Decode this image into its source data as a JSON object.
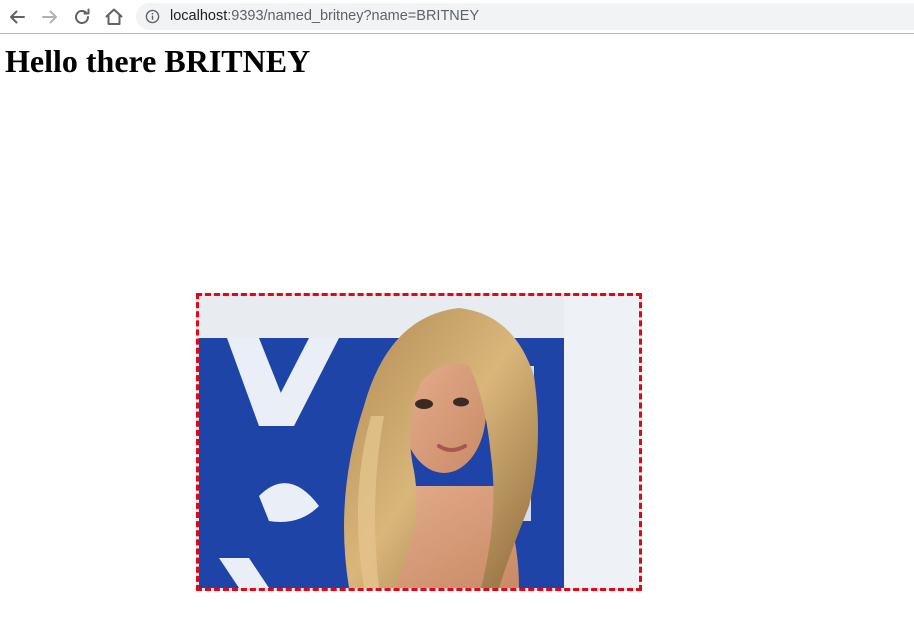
{
  "browser": {
    "url_host": "localhost",
    "url_rest": ":9393/named_britney?name=BRITNEY",
    "icons": [
      "back-arrow-icon",
      "forward-arrow-icon",
      "reload-icon",
      "home-icon",
      "info-icon"
    ]
  },
  "page": {
    "heading": "Hello there BRITNEY"
  },
  "photo": {
    "subject": "portrait photo",
    "frame_border_color": "#e30613",
    "backdrop_color": "#1f44a8"
  },
  "colors": {
    "toolbar_icon": "#5f6368",
    "toolbar_icon_disabled": "#b0b3b6",
    "urlbar_bg": "#f1f3f4"
  }
}
